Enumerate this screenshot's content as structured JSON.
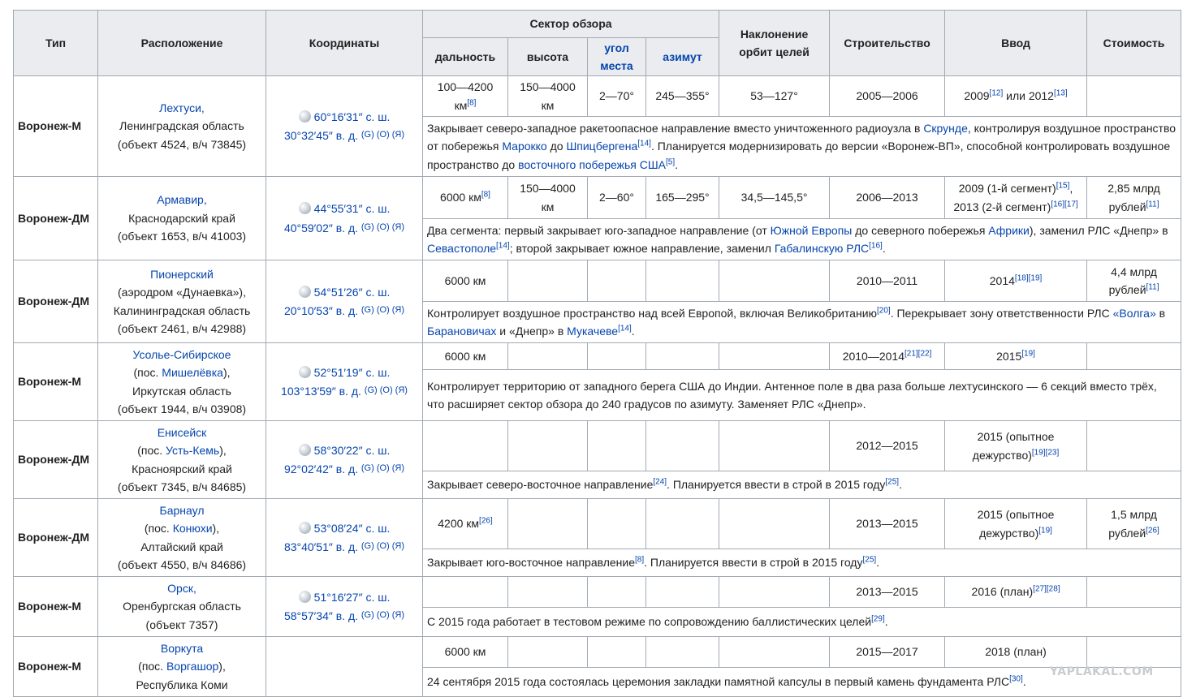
{
  "headers": {
    "type": "Тип",
    "location": "Расположение",
    "coords": "Координаты",
    "sector": "Сектор обзора",
    "range": "дальность",
    "height": "высота",
    "angle": "угол места",
    "azimuth": "азимут",
    "incline": "Наклонение орбит целей",
    "construction": "Строительство",
    "commission": "Ввод",
    "cost": "Стоимость"
  },
  "rows": [
    {
      "type": "Воронеж-М",
      "loc_link": "Лехтуси,",
      "loc_lines": [
        "Ленинградская область",
        "(объект 4524, в/ч 73845)"
      ],
      "lat": "60°16′31″ с. ш.",
      "lon": "30°32′45″ в. д.",
      "gor": "(G) (O) (Я)",
      "range": "100—4200 км",
      "range_ref": "[8]",
      "height": "150—4000 км",
      "angle": "2—70°",
      "azimuth": "245—355°",
      "incline": "53—127°",
      "construction": "2005—2006",
      "commission_a": "2009",
      "commission_a_ref": "[12]",
      "commission_mid": " или 2012",
      "commission_b_ref": "[13]",
      "cost": "",
      "desc_1": "Закрывает северо-западное ракетоопасное направление вместо уничтоженного радиоузла в ",
      "desc_link_1": "Скрунде",
      "desc_2": ", контролируя воздушное пространство от побережья ",
      "desc_link_2": "Марокко",
      "desc_3": " до ",
      "desc_link_3": "Шпицбергена",
      "desc_ref_1": "[14]",
      "desc_4": ". Планируется модернизировать до версии «Воронеж-ВП», способной контролировать воздушное пространство до ",
      "desc_link_4": "восточного побережья США",
      "desc_ref_2": "[5]",
      "desc_5": "."
    },
    {
      "type": "Воронеж-ДМ",
      "loc_link": "Армавир,",
      "loc_lines": [
        "Краснодарский край",
        "(объект 1653, в/ч 41003)"
      ],
      "lat": "44°55′31″ с. ш.",
      "lon": "40°59′02″ в. д.",
      "gor": "(G) (O) (Я)",
      "range": "6000 км",
      "range_ref": "[8]",
      "height": "150—4000 км",
      "angle": "2—60°",
      "azimuth": "165—295°",
      "incline": "34,5—145,5°",
      "construction": "2006—2013",
      "commission_a": "2009 (1-й сегмент)",
      "commission_a_ref": "[15]",
      "commission_b": "2013 (2-й сегмент)",
      "commission_b_ref": "[16][17]",
      "cost_a": "2,85 млрд",
      "cost_b": "рублей",
      "cost_ref": "[11]",
      "desc_1": "Два сегмента: первый закрывает юго-западное направление (от ",
      "desc_link_1": "Южной Европы",
      "desc_2": " до северного побережья ",
      "desc_link_2": "Африки",
      "desc_3": "), заменил РЛС «Днепр» в ",
      "desc_link_3": "Севастополе",
      "desc_ref_1": "[14]",
      "desc_4": "; второй закрывает южное направление, заменил ",
      "desc_link_4": "Габалинскую РЛС",
      "desc_ref_2": "[16]",
      "desc_5": "."
    },
    {
      "type": "Воронеж-ДМ",
      "loc_link": "Пионерский",
      "loc_lines": [
        "(аэродром «Дунаевка»),",
        "Калининградская область",
        "(объект 2461, в/ч 42988)"
      ],
      "lat": "54°51′26″ с. ш.",
      "lon": "20°10′53″ в. д.",
      "gor": "(G) (O) (Я)",
      "range": "6000 км",
      "construction": "2010—2011",
      "commission_a": "2014",
      "commission_a_ref": "[18][19]",
      "cost_a": "4,4 млрд",
      "cost_b": "рублей",
      "cost_ref": "[11]",
      "desc_1": "Контролирует воздушное пространство над всей Европой, включая Великобританию",
      "desc_ref_1": "[20]",
      "desc_2": ". Перекрывает зону ответственности РЛС ",
      "desc_link_1": "«Волга»",
      "desc_3": " в ",
      "desc_link_2": "Барановичах",
      "desc_4": " и «Днепр» в ",
      "desc_link_3": "Мукачеве",
      "desc_ref_2": "[14]",
      "desc_5": "."
    },
    {
      "type": "Воронеж-М",
      "loc_link": "Усолье-Сибирское",
      "loc_pre": "(пос. ",
      "loc_link2": "Мишелёвка",
      "loc_post": "),",
      "loc_lines": [
        "Иркутская область",
        "(объект 1944, в/ч 03908)"
      ],
      "lat": "52°51′19″ с. ш.",
      "lon": "103°13′59″ в. д.",
      "gor": "(G) (O) (Я)",
      "range": "6000 км",
      "construction": "2010—2014",
      "construction_ref": "[21][22]",
      "commission_a": "2015",
      "commission_a_ref": "[19]",
      "desc_1": "Контролирует территорию от западного берега США до Индии. Антенное поле в два раза больше лехтусинского — 6 секций вместо трёх, что расширяет сектор обзора до 240 градусов по азимуту. Заменяет РЛС «Днепр»."
    },
    {
      "type": "Воронеж-ДМ",
      "loc_link": "Енисейск",
      "loc_pre": "(пос. ",
      "loc_link2": "Усть-Кемь",
      "loc_post": "),",
      "loc_lines": [
        "Красноярский край",
        "(объект 7345, в/ч 84685)"
      ],
      "lat": "58°30′22″ с. ш.",
      "lon": "92°02′42″ в. д.",
      "gor": "(G) (O) (Я)",
      "construction": "2012—2015",
      "commission_a": "2015 (опытное",
      "commission_b": "дежурство)",
      "commission_b_ref": "[19][23]",
      "desc_1": "Закрывает северо-восточное направление",
      "desc_ref_1": "[24]",
      "desc_2": ". Планируется ввести в строй в 2015 году",
      "desc_ref_2": "[25]",
      "desc_3": "."
    },
    {
      "type": "Воронеж-ДМ",
      "loc_link": "Барнаул",
      "loc_pre": "(пос. ",
      "loc_link2": "Конюхи",
      "loc_post": "),",
      "loc_lines": [
        "Алтайский край",
        "(объект 4550, в/ч 84686)"
      ],
      "lat": "53°08′24″ с. ш.",
      "lon": "83°40′51″ в. д.",
      "gor": "(G) (O) (Я)",
      "range": "4200 км",
      "range_ref": "[26]",
      "construction": "2013—2015",
      "commission_a": "2015 (опытное",
      "commission_b": "дежурство)",
      "commission_b_ref": "[19]",
      "cost_a": "1,5 млрд",
      "cost_b": "рублей",
      "cost_ref": "[26]",
      "desc_1": "Закрывает юго-восточное направление",
      "desc_ref_1": "[8]",
      "desc_2": ". Планируется ввести в строй в 2015 году",
      "desc_ref_2": "[25]",
      "desc_3": "."
    },
    {
      "type": "Воронеж-М",
      "loc_link": "Орск,",
      "loc_lines": [
        "Оренбургская область",
        "(объект 7357)"
      ],
      "lat": "51°16′27″ с. ш.",
      "lon": "58°57′34″ в. д.",
      "gor": "(G) (O) (Я)",
      "construction": "2013—2015",
      "commission_a": "2016 (план)",
      "commission_a_ref": "[27][28]",
      "desc_1": "С 2015 года работает в тестовом режиме по сопровождению баллистических целей",
      "desc_ref_1": "[29]",
      "desc_2": "."
    },
    {
      "type": "Воронеж-М",
      "loc_link": "Воркута",
      "loc_pre": "(пос. ",
      "loc_link2": "Воргашор",
      "loc_post": "),",
      "loc_lines": [
        "Республика Коми"
      ],
      "range": "6000 км",
      "construction": "2015—2017",
      "commission_a": "2018 (план)",
      "desc_1": "24 сентября 2015 года состоялась церемония закладки памятной капсулы в первый камень фундамента РЛС",
      "desc_ref_1": "[30]",
      "desc_2": "."
    }
  ],
  "watermark": "YAPLAKAL.COM"
}
